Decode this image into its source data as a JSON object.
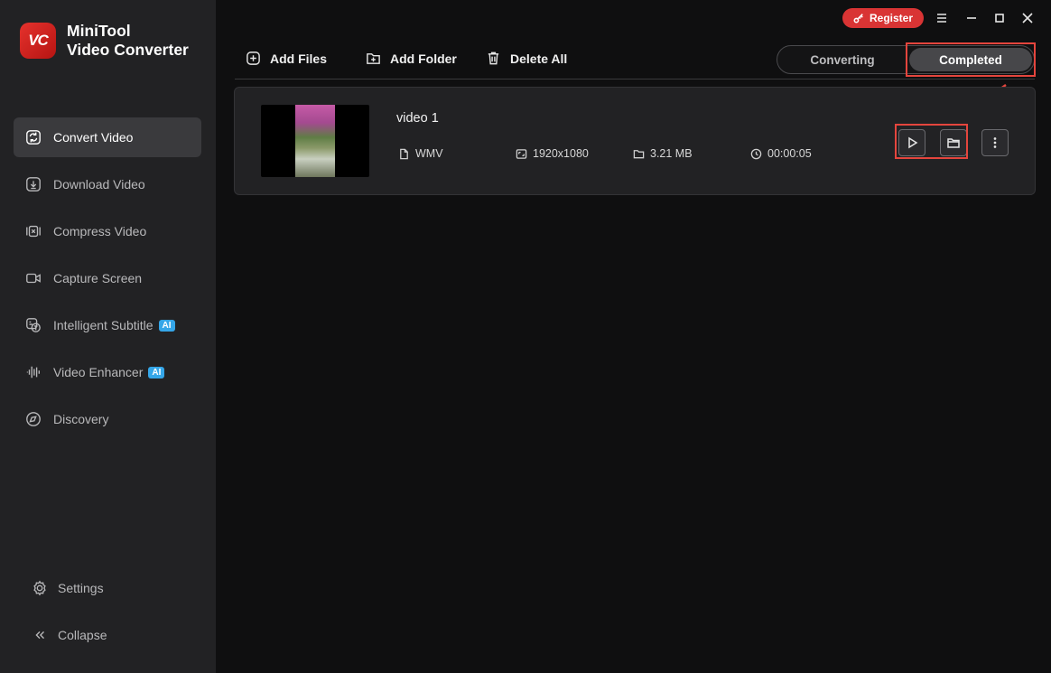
{
  "app": {
    "brand_line1": "MiniTool",
    "brand_line2": "Video Converter",
    "logo_text": "VC",
    "accent_color": "#d93434"
  },
  "window": {
    "register_label": "Register",
    "menu_icon": "hamburger-icon",
    "minimize_icon": "minimize-icon",
    "maximize_icon": "maximize-icon",
    "close_icon": "close-icon"
  },
  "sidebar": {
    "items": [
      {
        "label": "Convert Video",
        "icon": "convert-icon",
        "active": true
      },
      {
        "label": "Download Video",
        "icon": "download-icon"
      },
      {
        "label": "Compress Video",
        "icon": "compress-icon"
      },
      {
        "label": "Capture Screen",
        "icon": "camera-icon"
      },
      {
        "label": "Intelligent Subtitle",
        "icon": "subtitle-icon",
        "badge": "AI"
      },
      {
        "label": "Video Enhancer",
        "icon": "waveform-icon",
        "badge": "AI"
      },
      {
        "label": "Discovery",
        "icon": "compass-icon"
      }
    ],
    "settings_label": "Settings",
    "collapse_label": "Collapse"
  },
  "toolbar": {
    "add_files": "Add Files",
    "add_folder": "Add Folder",
    "delete_all": "Delete All"
  },
  "tabs": {
    "converting": "Converting",
    "completed": "Completed",
    "selected": "Completed"
  },
  "files": [
    {
      "name": "video 1",
      "format": "WMV",
      "resolution": "1920x1080",
      "size": "3.21 MB",
      "duration": "00:00:05"
    }
  ]
}
